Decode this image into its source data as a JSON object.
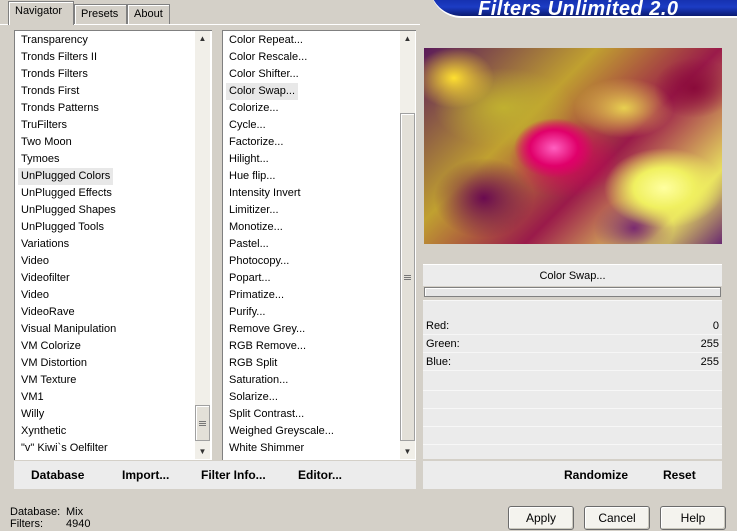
{
  "banner": {
    "title": "Filters Unlimited 2.0"
  },
  "tabs": [
    {
      "label": "Navigator"
    },
    {
      "label": "Presets"
    },
    {
      "label": "About"
    }
  ],
  "categories": {
    "items": [
      "Transparency",
      "Tronds Filters II",
      "Tronds Filters",
      "Tronds First",
      "Tronds Patterns",
      "TruFilters",
      "Two Moon",
      "Tymoes",
      "UnPlugged Colors",
      "UnPlugged Effects",
      "UnPlugged Shapes",
      "UnPlugged Tools",
      "Variations",
      "Video",
      "Videofilter",
      "Video",
      "VideoRave",
      "Visual Manipulation",
      "VM Colorize",
      "VM Distortion",
      "VM Texture",
      "VM1",
      "Willy",
      "Xynthetic",
      "\"v\" Kiwi`s Oelfilter"
    ],
    "selected": "UnPlugged Colors"
  },
  "filters": {
    "items": [
      "Color Repeat...",
      "Color Rescale...",
      "Color Shifter...",
      "Color Swap...",
      "Colorize...",
      "Cycle...",
      "Factorize...",
      "Hilight...",
      "Hue flip...",
      "Intensity Invert",
      "Limitizer...",
      "Monotize...",
      "Pastel...",
      "Photocopy...",
      "Popart...",
      "Primatize...",
      "Purify...",
      "Remove Grey...",
      "RGB Remove...",
      "RGB Split",
      "Saturation...",
      "Solarize...",
      "Split Contrast...",
      "Weighed Greyscale...",
      "White Shimmer"
    ],
    "selected": "Color Swap..."
  },
  "filter_panel": {
    "title": "Color Swap...",
    "params": [
      {
        "label": "Red:",
        "value": "0"
      },
      {
        "label": "Green:",
        "value": "255"
      },
      {
        "label": "Blue:",
        "value": "255"
      }
    ]
  },
  "left_toolbar": {
    "database": "Database",
    "import": "Import...",
    "filter_info": "Filter Info...",
    "editor": "Editor..."
  },
  "right_toolbar": {
    "randomize": "Randomize",
    "reset": "Reset"
  },
  "status": {
    "database_label": "Database:",
    "database_value": "Mix",
    "filters_label": "Filters:",
    "filters_value": "4940"
  },
  "buttons": {
    "apply": "Apply",
    "cancel": "Cancel",
    "help": "Help"
  }
}
